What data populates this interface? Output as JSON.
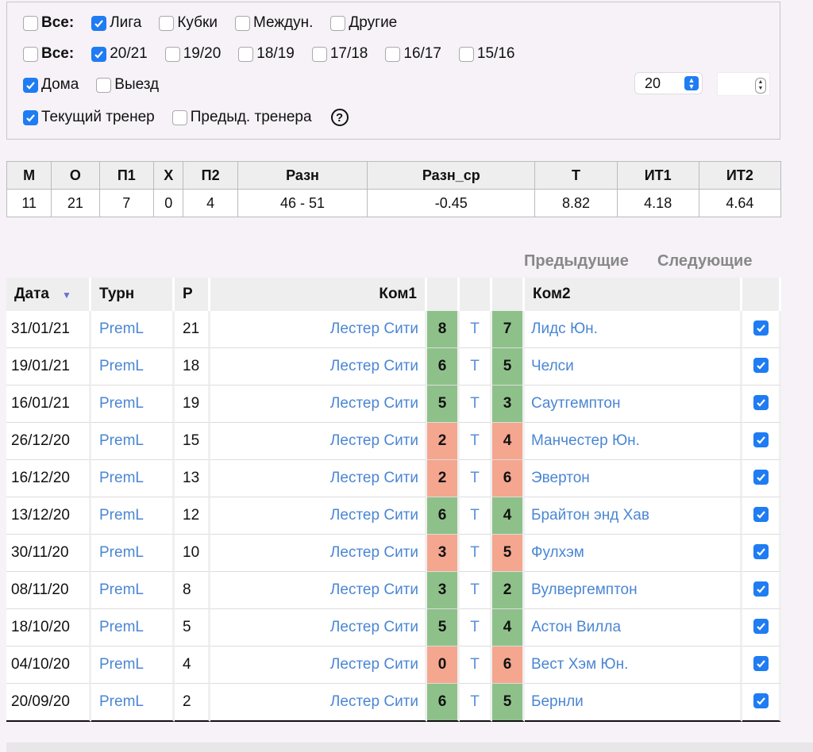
{
  "filters": {
    "row1": {
      "all_label": "Все:",
      "items": [
        {
          "label": "Лига",
          "checked": true
        },
        {
          "label": "Кубки",
          "checked": false
        },
        {
          "label": "Междун.",
          "checked": false
        },
        {
          "label": "Другие",
          "checked": false
        }
      ]
    },
    "row2": {
      "all_label": "Все:",
      "items": [
        {
          "label": "20/21",
          "checked": true
        },
        {
          "label": "19/20",
          "checked": false
        },
        {
          "label": "18/19",
          "checked": false
        },
        {
          "label": "17/18",
          "checked": false
        },
        {
          "label": "16/17",
          "checked": false
        },
        {
          "label": "15/16",
          "checked": false
        }
      ]
    },
    "row3": {
      "items": [
        {
          "label": "Дома",
          "checked": true
        },
        {
          "label": "Выезд",
          "checked": false
        }
      ]
    },
    "row4": {
      "items": [
        {
          "label": "Текущий тренер",
          "checked": true
        },
        {
          "label": "Предыд. тренера",
          "checked": false
        }
      ],
      "help": "?"
    },
    "count_select": "20",
    "number_input": ""
  },
  "stats": {
    "headers": [
      "М",
      "О",
      "П1",
      "Х",
      "П2",
      "Разн",
      "Разн_ср",
      "Т",
      "ИТ1",
      "ИТ2"
    ],
    "values": [
      "11",
      "21",
      "7",
      "0",
      "4",
      "46 - 51",
      "-0.45",
      "8.82",
      "4.18",
      "4.64"
    ]
  },
  "pager": {
    "prev": "Предыдущие",
    "next": "Следующие"
  },
  "matches": {
    "headers": {
      "date": "Дата",
      "turn": "Турн",
      "r": "Р",
      "team1": "Ком1",
      "team2": "Ком2"
    },
    "t_label": "Т",
    "rows": [
      {
        "date": "31/01/21",
        "turn": "PremL",
        "r": "21",
        "team1": "Лестер Сити",
        "s1": "8",
        "s2": "7",
        "team2": "Лидс Юн.",
        "result": "win"
      },
      {
        "date": "19/01/21",
        "turn": "PremL",
        "r": "18",
        "team1": "Лестер Сити",
        "s1": "6",
        "s2": "5",
        "team2": "Челси",
        "result": "win"
      },
      {
        "date": "16/01/21",
        "turn": "PremL",
        "r": "19",
        "team1": "Лестер Сити",
        "s1": "5",
        "s2": "3",
        "team2": "Саутгемптон",
        "result": "win"
      },
      {
        "date": "26/12/20",
        "turn": "PremL",
        "r": "15",
        "team1": "Лестер Сити",
        "s1": "2",
        "s2": "4",
        "team2": "Манчестер Юн.",
        "result": "loss"
      },
      {
        "date": "16/12/20",
        "turn": "PremL",
        "r": "13",
        "team1": "Лестер Сити",
        "s1": "2",
        "s2": "6",
        "team2": "Эвертон",
        "result": "loss"
      },
      {
        "date": "13/12/20",
        "turn": "PremL",
        "r": "12",
        "team1": "Лестер Сити",
        "s1": "6",
        "s2": "4",
        "team2": "Брайтон энд Хав",
        "result": "win"
      },
      {
        "date": "30/11/20",
        "turn": "PremL",
        "r": "10",
        "team1": "Лестер Сити",
        "s1": "3",
        "s2": "5",
        "team2": "Фулхэм",
        "result": "loss"
      },
      {
        "date": "08/11/20",
        "turn": "PremL",
        "r": "8",
        "team1": "Лестер Сити",
        "s1": "3",
        "s2": "2",
        "team2": "Вулвергемптон",
        "result": "win"
      },
      {
        "date": "18/10/20",
        "turn": "PremL",
        "r": "5",
        "team1": "Лестер Сити",
        "s1": "5",
        "s2": "4",
        "team2": "Астон Вилла",
        "result": "win"
      },
      {
        "date": "04/10/20",
        "turn": "PremL",
        "r": "4",
        "team1": "Лестер Сити",
        "s1": "0",
        "s2": "6",
        "team2": "Вест Хэм Юн.",
        "result": "loss"
      },
      {
        "date": "20/09/20",
        "turn": "PremL",
        "r": "2",
        "team1": "Лестер Сити",
        "s1": "6",
        "s2": "5",
        "team2": "Бернли",
        "result": "win"
      }
    ]
  },
  "colors": {
    "accent": "#1f7cf2",
    "link": "#4a86d4",
    "win": "#8ec18a",
    "loss": "#f4a68f"
  }
}
